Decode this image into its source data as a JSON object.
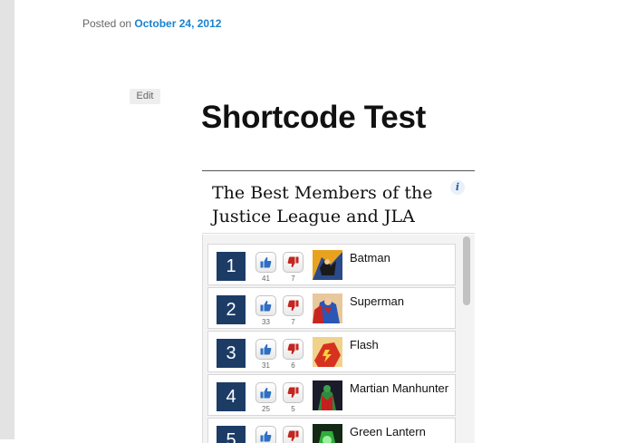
{
  "post": {
    "posted_prefix": "Posted on",
    "date": "October 24, 2012",
    "edit_label": "Edit",
    "title": "Shortcode Test"
  },
  "widget": {
    "title": "The Best Members of the Justice League and JLA",
    "info_glyph": "i"
  },
  "list": [
    {
      "rank": "1",
      "name": "Batman",
      "up": "41",
      "down": "7"
    },
    {
      "rank": "2",
      "name": "Superman",
      "up": "33",
      "down": "7"
    },
    {
      "rank": "3",
      "name": "Flash",
      "up": "31",
      "down": "6"
    },
    {
      "rank": "4",
      "name": "Martian Manhunter",
      "up": "25",
      "down": "5"
    },
    {
      "rank": "5",
      "name": "Green Lantern",
      "up": "",
      "down": ""
    }
  ],
  "colors": {
    "link": "#1982d1",
    "rank_badge": "#1c3c66",
    "vote_up": "#2e6fc4",
    "vote_down": "#c4251f"
  }
}
